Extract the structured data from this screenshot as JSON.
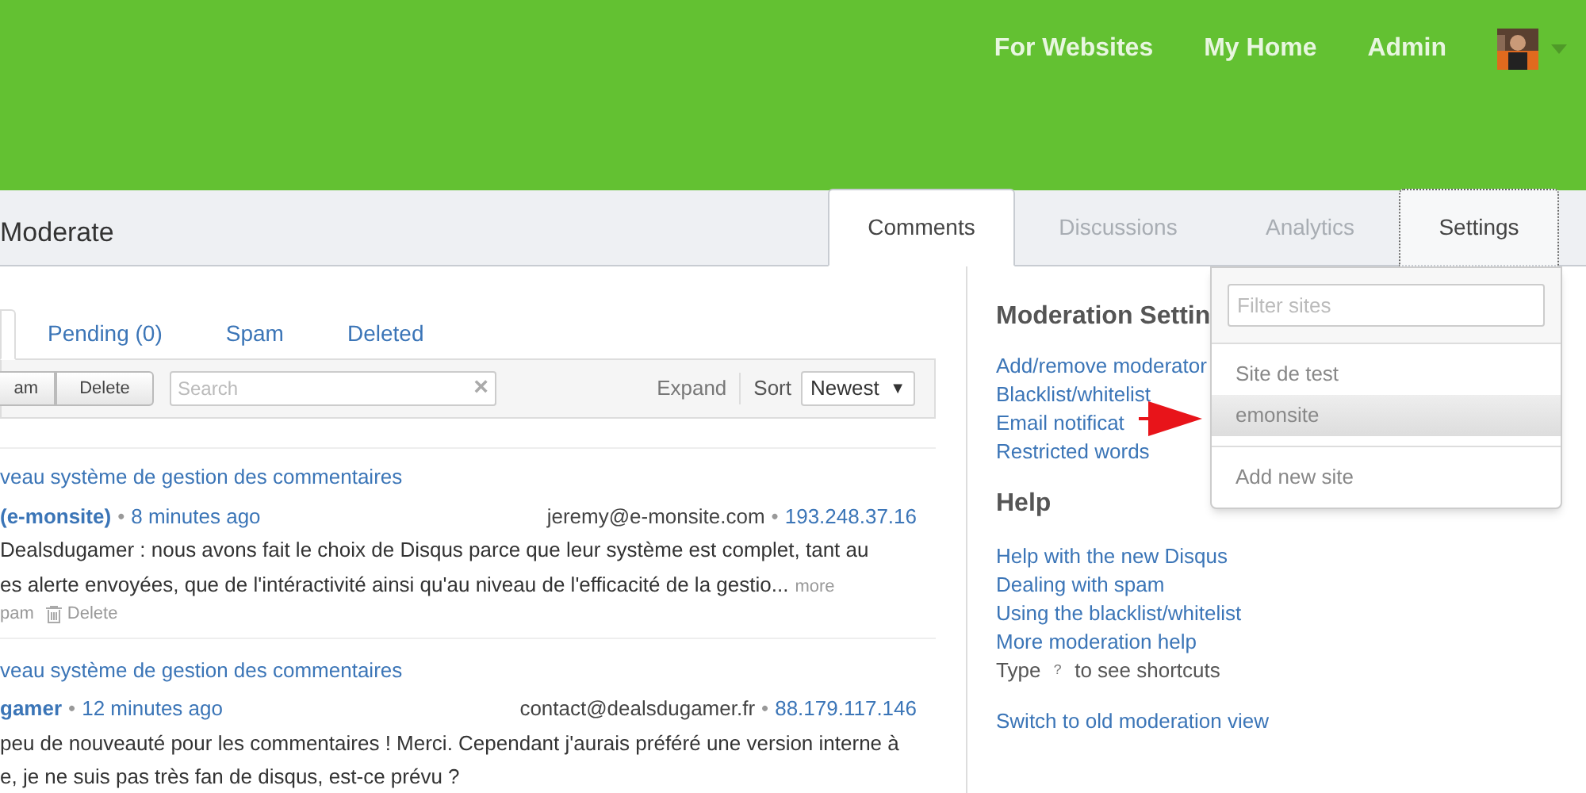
{
  "top_nav": {
    "links": [
      "For Websites",
      "My Home",
      "Admin"
    ],
    "avatar": {
      "kind": "picture"
    }
  },
  "page_title": "Moderate",
  "tabs": [
    {
      "label": "Comments",
      "selected": true
    },
    {
      "label": "Discussions",
      "selected": false
    },
    {
      "label": "Analytics",
      "selected": false
    },
    {
      "label": "Settings",
      "selected": false,
      "open": true
    }
  ],
  "sub_tabs": [
    {
      "selected": true
    },
    {
      "label": "Pending (0)",
      "selected": false
    },
    {
      "label": "Spam",
      "selected": false
    },
    {
      "label": "Deleted",
      "selected": false
    }
  ],
  "toolbar": {
    "buttons": [
      "am",
      "Delete"
    ],
    "search": {
      "placeholder": "Search",
      "clear": "×"
    },
    "expand": "Expand",
    "sort_label": "Sort",
    "sort_value": "Newest",
    "sort_caret": "▼"
  },
  "comments": [
    {
      "thread": "veau système de gestion des commentaires",
      "author": "(e-monsite)",
      "time": "8 minutes ago",
      "email": "jeremy@e-monsite.com",
      "ip": "193.248.37.16",
      "separators": [
        "•",
        "•"
      ],
      "lines": [
        "Dealsdugamer : nous avons fait le choix de Disqus parce que leur système est complet, tant au",
        "es alerte envoyées, que de l'intéractivité ainsi qu'au niveau de l'efficacité de la gestio..."
      ],
      "more": "more",
      "actions": [
        "pam",
        "Delete"
      ]
    },
    {
      "thread": "veau système de gestion des commentaires",
      "author": "gamer",
      "time": "12 minutes ago",
      "email": "contact@dealsdugamer.fr",
      "ip": "88.179.117.146",
      "separators": [
        "•",
        "•"
      ],
      "lines": [
        "peu de nouveauté pour les commentaires ! Merci. Cependant j'aurais préféré une version interne à",
        "e, je ne suis pas très fan de disqus, est-ce prévu ?"
      ]
    }
  ],
  "sidebar": {
    "settings_title": "Moderation Settin",
    "settings_links": [
      "Add/remove moderator",
      "Blacklist/whitelist",
      "Email notificat",
      "Restricted words"
    ],
    "help_title": "Help",
    "help_links": [
      "Help with the new Disqus",
      "Dealing with spam",
      "Using the blacklist/whitelist",
      "More moderation help"
    ],
    "shortcut": {
      "before": "Type",
      "key": "?",
      "after": "to see shortcuts"
    },
    "switch_link": "Switch to old moderation view"
  },
  "site_menu": {
    "filter_placeholder": "Filter sites",
    "sites": [
      {
        "label": "Site de test",
        "highlighted": false
      },
      {
        "label": "emonsite",
        "highlighted": true
      }
    ],
    "add": "Add new site"
  }
}
